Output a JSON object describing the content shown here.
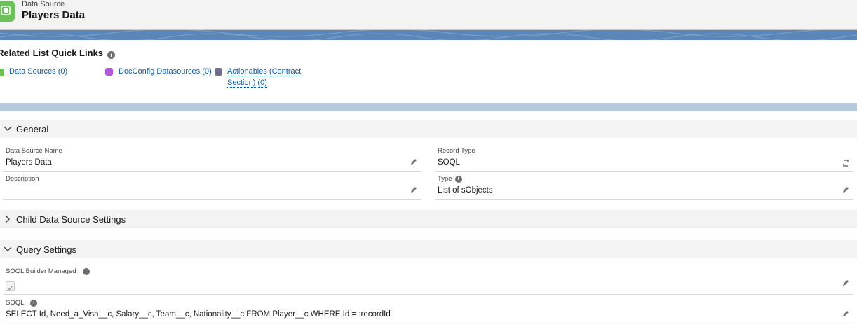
{
  "header": {
    "object_label": "Data Source",
    "record_title": "Players Data",
    "icon": "datasource-chip-icon"
  },
  "quick_links": {
    "title": "Related List Quick Links",
    "links": [
      {
        "label": "Data Sources (0)",
        "icon": "data-source-icon",
        "color": "#6cc15a"
      },
      {
        "label": "DocConfig Datasources (0)",
        "icon": "docconfig-icon",
        "color": "#b157e0"
      },
      {
        "label_line1": "Actionables (Contract",
        "label_line2": "Section) (0)",
        "icon": "wrench-icon",
        "color": "#706e8b"
      }
    ]
  },
  "sections": {
    "general": {
      "title": "General",
      "fields": {
        "name": {
          "label": "Data Source Name",
          "value": "Players Data"
        },
        "record_type": {
          "label": "Record Type",
          "value": "SOQL"
        },
        "description": {
          "label": "Description",
          "value": ""
        },
        "type": {
          "label": "Type",
          "value": "List of sObjects"
        }
      }
    },
    "child": {
      "title": "Child Data Source Settings"
    },
    "query": {
      "title": "Query Settings",
      "fields": {
        "builder_managed": {
          "label": "SOQL Builder Managed",
          "checked": true
        },
        "soql": {
          "label": "SOQL",
          "value": "SELECT Id, Need_a_Visa__c, Salary__c, Team__c, Nationality__c FROM Player__c WHERE Id = :recordId"
        }
      }
    }
  },
  "colors": {
    "link": "#0b5cab",
    "band": "#5b87b8",
    "section_bg": "#f3f3f3"
  }
}
